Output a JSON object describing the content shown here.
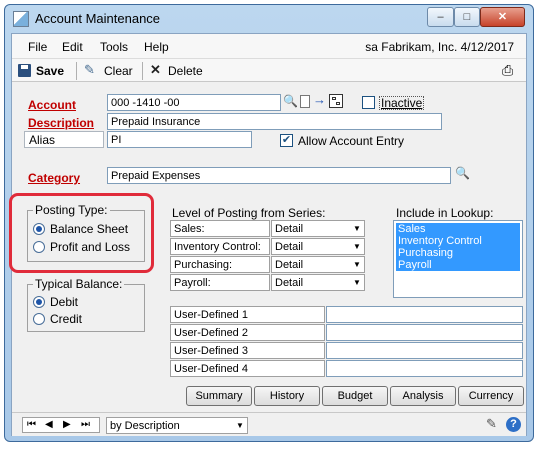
{
  "window": {
    "title": "Account Maintenance",
    "caption_buttons": {
      "minimize": "–",
      "maximize": "□",
      "close": "✕"
    }
  },
  "menu": {
    "items": [
      "File",
      "Edit",
      "Tools",
      "Help"
    ],
    "company_info": "sa  Fabrikam, Inc.  4/12/2017"
  },
  "toolbar": {
    "save_label": "Save",
    "clear_label": "Clear",
    "delete_label": "Delete"
  },
  "form": {
    "account_label": "Account",
    "account_value": "000 -1410 -00",
    "inactive_label": "Inactive",
    "inactive_checked": false,
    "description_label": "Description",
    "description_value": "Prepaid Insurance",
    "alias_label": "Alias",
    "alias_value": "PI",
    "allow_entry_label": "Allow Account Entry",
    "allow_entry_checked": true,
    "category_label": "Category",
    "category_value": "Prepaid Expenses"
  },
  "posting_type": {
    "title": "Posting Type:",
    "options": [
      "Balance Sheet",
      "Profit and Loss"
    ],
    "selected": "Balance Sheet"
  },
  "typical_balance": {
    "title": "Typical Balance:",
    "options": [
      "Debit",
      "Credit"
    ],
    "selected": "Debit"
  },
  "level_of_posting": {
    "title": "Level of Posting from Series:",
    "rows": [
      {
        "series": "Sales:",
        "value": "Detail"
      },
      {
        "series": "Inventory Control:",
        "value": "Detail"
      },
      {
        "series": "Purchasing:",
        "value": "Detail"
      },
      {
        "series": "Payroll:",
        "value": "Detail"
      }
    ]
  },
  "include_in_lookup": {
    "title": "Include in Lookup:",
    "items": [
      "Sales",
      "Inventory Control",
      "Purchasing",
      "Payroll"
    ]
  },
  "user_defined": {
    "labels": [
      "User-Defined 1",
      "User-Defined 2",
      "User-Defined 3",
      "User-Defined 4"
    ],
    "values": [
      "",
      "",
      "",
      ""
    ]
  },
  "buttons": [
    "Summary",
    "History",
    "Budget",
    "Analysis",
    "Currency"
  ],
  "statusbar": {
    "sort_value": "by Description"
  },
  "colors": {
    "highlight_ring": "#e02b3a",
    "required_label": "#c00000",
    "selection": "#3399ff"
  }
}
